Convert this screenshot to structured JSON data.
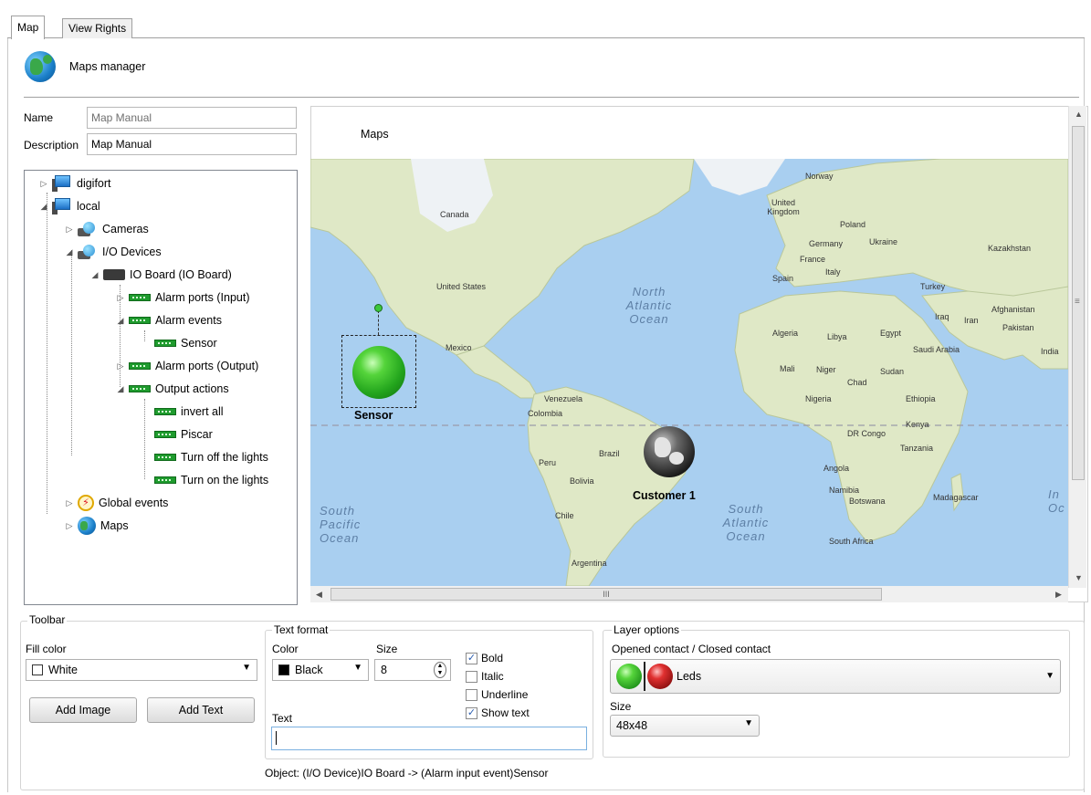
{
  "tabs": [
    {
      "label": "Map"
    },
    {
      "label": "View Rights"
    }
  ],
  "header": {
    "title": "Maps manager",
    "icon": "globe-icon"
  },
  "form": {
    "name_label": "Name",
    "name_value": "Map Manual",
    "description_label": "Description",
    "description_value": "Map Manual"
  },
  "tree": {
    "digifort": "digifort",
    "local": "local",
    "cameras": "Cameras",
    "io_devices": "I/O Devices",
    "io_board": "IO Board (IO Board)",
    "alarm_ports_input": "Alarm ports (Input)",
    "alarm_events": "Alarm events",
    "sensor": "Sensor",
    "alarm_ports_output": "Alarm ports (Output)",
    "output_actions": "Output actions",
    "invert_all": "invert all",
    "piscar": "Piscar",
    "turn_off": "Turn off the lights",
    "turn_on": "Turn on the lights",
    "global_events": "Global events",
    "maps": "Maps"
  },
  "map": {
    "title": "Maps",
    "sensor_label": "Sensor",
    "customer_label": "Customer 1",
    "places": {
      "norway": "Norway",
      "uk": "United Kingdom",
      "poland": "Poland",
      "germany": "Germany",
      "ukraine": "Ukraine",
      "kazakhstan": "Kazakhstan",
      "france": "France",
      "italy": "Italy",
      "spain": "Spain",
      "turkey": "Turkey",
      "afghanistan": "Afghanistan",
      "iraq": "Iraq",
      "iran": "Iran",
      "pakistan": "Pakistan",
      "india": "India",
      "egypt": "Egypt",
      "algeria": "Algeria",
      "libya": "Libya",
      "saudi": "Saudi Arabia",
      "mali": "Mali",
      "niger": "Niger",
      "chad": "Chad",
      "sudan": "Sudan",
      "nigeria": "Nigeria",
      "ethiopia": "Ethiopia",
      "kenya": "Kenya",
      "drc": "DR Congo",
      "tanzania": "Tanzania",
      "angola": "Angola",
      "namibia": "Namibia",
      "botswana": "Botswana",
      "madagascar": "Madagascar",
      "south_africa": "South Africa",
      "canada": "Canada",
      "usa": "United States",
      "mexico": "Mexico",
      "venezuela": "Venezuela",
      "colombia": "Colombia",
      "peru": "Peru",
      "brazil": "Brazil",
      "bolivia": "Bolivia",
      "chile": "Chile",
      "argentina": "Argentina",
      "n_atlantic": "North\nAtlantic\nOcean",
      "s_atlantic": "South\nAtlantic\nOcean",
      "s_pacific": "South\nPacific\nOcean",
      "indian": "In\nOc"
    },
    "hscroll_grip": "III",
    "grip": "≡"
  },
  "toolbar": {
    "group_label": "Toolbar",
    "fill_color_label": "Fill color",
    "fill_color_value": "White",
    "add_image": "Add Image",
    "add_text": "Add Text"
  },
  "text_format": {
    "group_label": "Text format",
    "color_label": "Color",
    "color_value": "Black",
    "size_label": "Size",
    "size_value": "8",
    "bold": "Bold",
    "bold_checked": true,
    "italic": "Italic",
    "italic_checked": false,
    "underline": "Underline",
    "underline_checked": false,
    "show_text": "Show text",
    "show_text_checked": true,
    "text_label": "Text",
    "text_value": ""
  },
  "layer_options": {
    "group_label": "Layer options",
    "contact_label": "Opened contact / Closed contact",
    "contact_value": "Leds",
    "size_label": "Size",
    "size_value": "48x48"
  },
  "status": {
    "object_text": "Object:  (I/O Device)IO Board -> (Alarm input event)Sensor"
  },
  "colors": {
    "map_water": "#a9cff0",
    "land": "#d9e7c0",
    "led_green": "#2fb82f",
    "led_red": "#cc1b1b"
  }
}
